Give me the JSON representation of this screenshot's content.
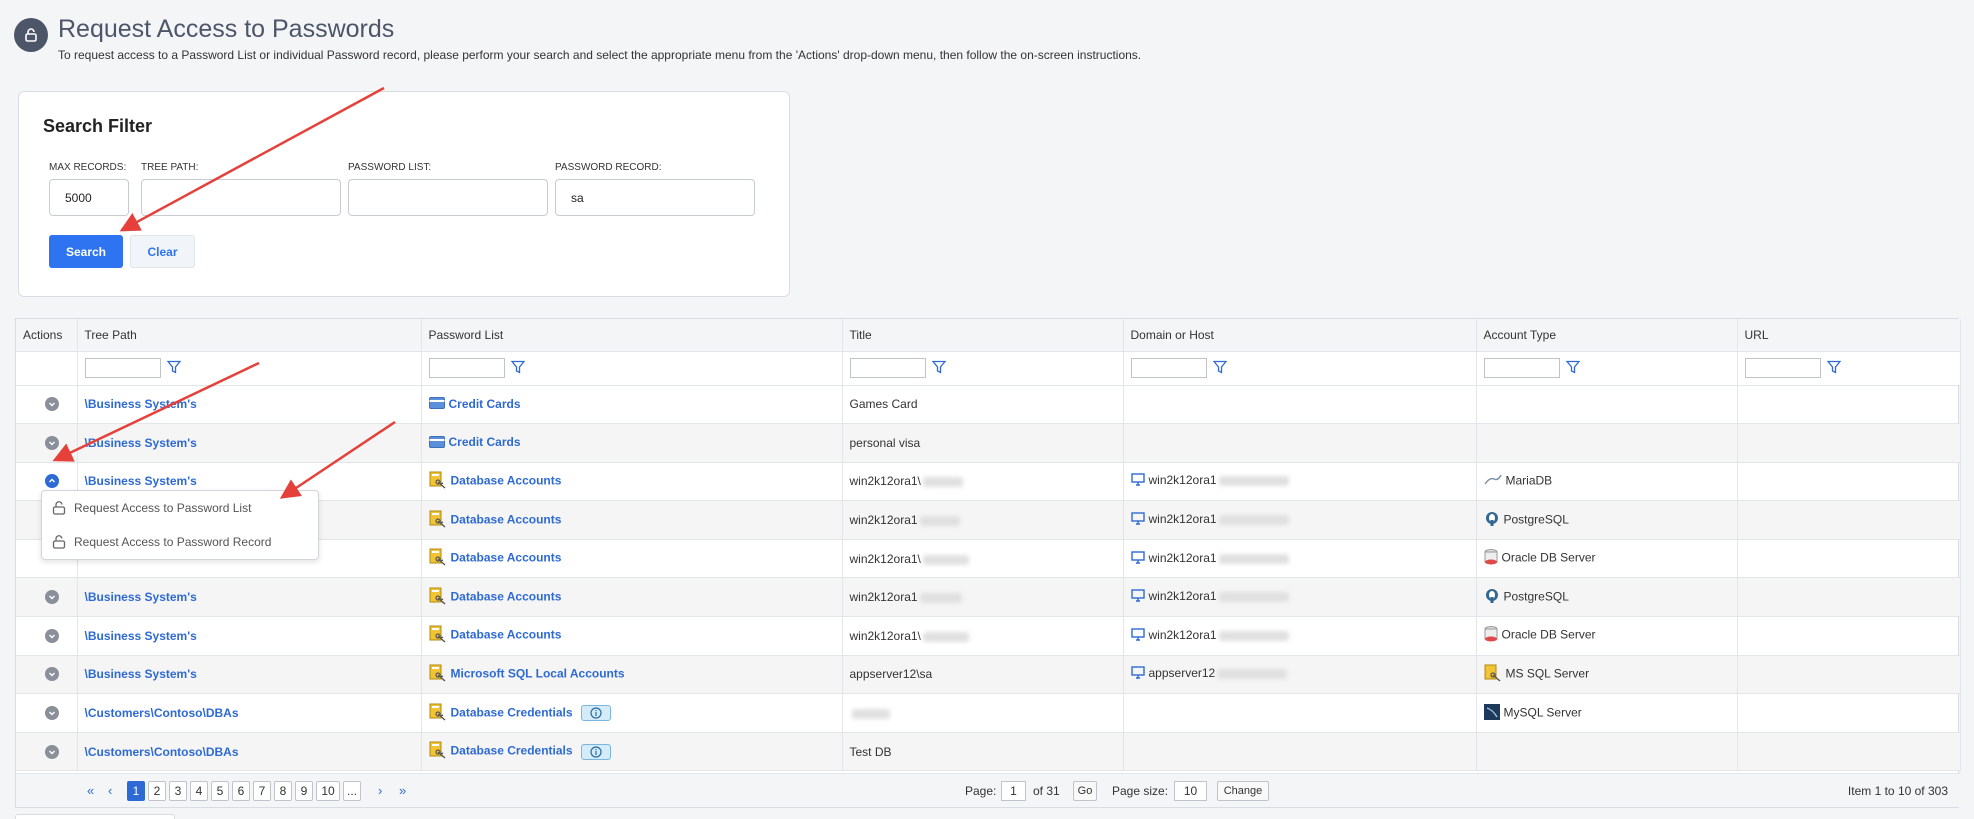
{
  "header": {
    "title": "Request Access to Passwords",
    "description": "To request access to a Password List or individual Password record, please perform your search and select the appropriate menu from the 'Actions' drop-down menu, then follow the on-screen instructions."
  },
  "search_filter": {
    "title": "Search Filter",
    "max_records_label": "MAX RECORDS:",
    "max_records_value": "5000",
    "tree_path_label": "TREE PATH:",
    "tree_path_value": "",
    "password_list_label": "PASSWORD LIST:",
    "password_list_value": "",
    "password_record_label": "PASSWORD RECORD:",
    "password_record_value": "sa",
    "search_button": "Search",
    "clear_button": "Clear"
  },
  "grid": {
    "columns": [
      "Actions",
      "Tree Path",
      "Password List",
      "Title",
      "Domain or Host",
      "Account Type",
      "URL"
    ],
    "rows": [
      {
        "tree_path": "\\Business System's",
        "password_list": "Credit Cards",
        "list_icon": "credit-card-icon",
        "title": "Games Card",
        "title_blurred": false,
        "host": "",
        "account_type": "",
        "account_icon": ""
      },
      {
        "tree_path": "\\Business System's",
        "password_list": "Credit Cards",
        "list_icon": "credit-card-icon",
        "title": "personal visa",
        "title_blurred": false,
        "host": "",
        "account_type": "",
        "account_icon": ""
      },
      {
        "tree_path": "\\Business System's",
        "password_list": "Database Accounts",
        "list_icon": "database-key-icon",
        "title": "win2k12ora1\\",
        "title_blurred": true,
        "host": "win2k12ora1",
        "account_type": "MariaDB",
        "account_icon": "mariadb-icon"
      },
      {
        "tree_path": "",
        "password_list": "Database Accounts",
        "list_icon": "database-key-icon",
        "title": "win2k12ora1",
        "title_blurred": true,
        "host": "win2k12ora1",
        "account_type": "PostgreSQL",
        "account_icon": "postgresql-icon"
      },
      {
        "tree_path": "",
        "password_list": "Database Accounts",
        "list_icon": "database-key-icon",
        "title": "win2k12ora1\\",
        "title_blurred": true,
        "host": "win2k12ora1",
        "account_type": "Oracle DB Server",
        "account_icon": "oracle-db-icon"
      },
      {
        "tree_path": "\\Business System's",
        "password_list": "Database Accounts",
        "list_icon": "database-key-icon",
        "title": "win2k12ora1",
        "title_blurred": true,
        "host": "win2k12ora1",
        "account_type": "PostgreSQL",
        "account_icon": "postgresql-icon"
      },
      {
        "tree_path": "\\Business System's",
        "password_list": "Database Accounts",
        "list_icon": "database-key-icon",
        "title": "win2k12ora1\\",
        "title_blurred": true,
        "host": "win2k12ora1",
        "account_type": "Oracle DB Server",
        "account_icon": "oracle-db-icon"
      },
      {
        "tree_path": "\\Business System's",
        "password_list": "Microsoft SQL Local Accounts",
        "list_icon": "database-key-icon",
        "title": "appserver12\\sa",
        "title_blurred": false,
        "host": "appserver12",
        "account_type": "MS SQL Server",
        "account_icon": "mssql-icon"
      },
      {
        "tree_path": "\\Customers\\Contoso\\DBAs",
        "password_list": "Database Credentials",
        "list_icon": "database-key-icon",
        "title": "",
        "title_blurred": true,
        "host": "",
        "account_type": "MySQL Server",
        "account_icon": "mysql-icon",
        "info": true
      },
      {
        "tree_path": "\\Customers\\Contoso\\DBAs",
        "password_list": "Database Credentials",
        "list_icon": "database-key-icon",
        "title": "Test DB",
        "title_blurred": false,
        "host": "",
        "account_type": "",
        "account_icon": "",
        "info": true
      }
    ]
  },
  "actions_menu": {
    "items": [
      "Request Access to Password List",
      "Request Access to Password Record"
    ]
  },
  "pager": {
    "pages": [
      "1",
      "2",
      "3",
      "4",
      "5",
      "6",
      "7",
      "8",
      "9",
      "10",
      "..."
    ],
    "current_page": "1",
    "page_label": "Page:",
    "page_value": "1",
    "of_label": "of 31",
    "go_button": "Go",
    "page_size_label": "Page size:",
    "page_size_value": "10",
    "change_button": "Change",
    "items_summary": "Item 1 to 10 of 303"
  },
  "colors": {
    "accent": "#2e74f0",
    "link": "#2e6ad4",
    "header_icon_bg": "#4d5669",
    "annotation_arrow": "#e5403a"
  }
}
